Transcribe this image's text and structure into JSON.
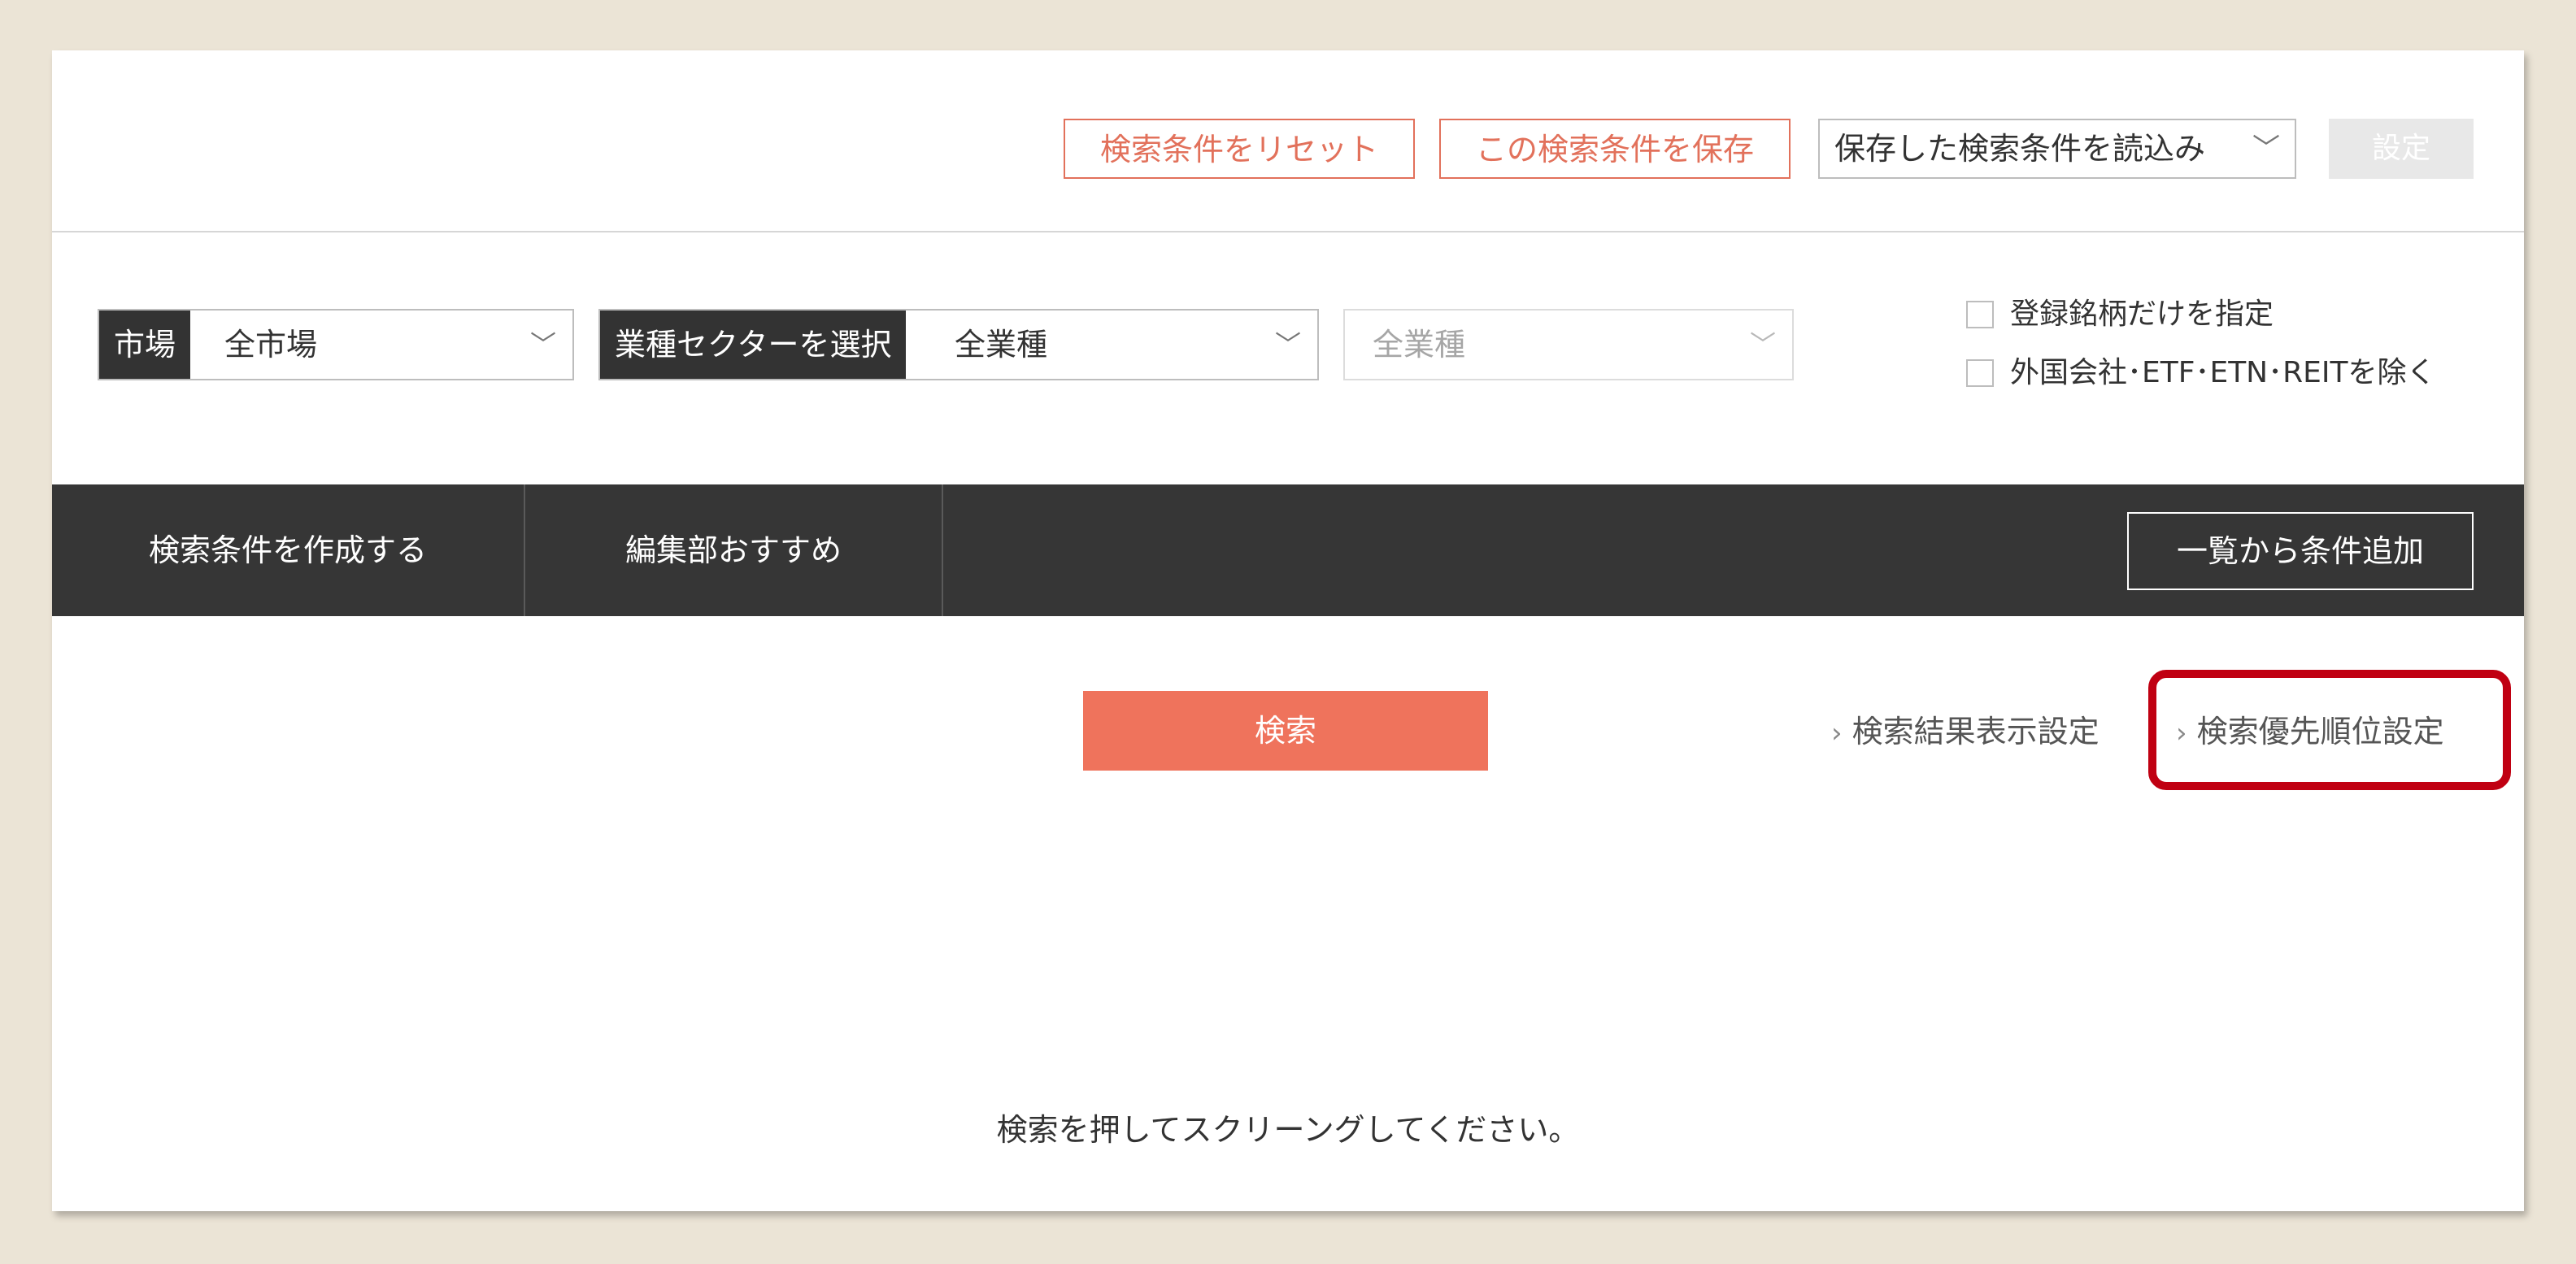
{
  "toolbar": {
    "reset_label": "検索条件をリセット",
    "save_label": "この検索条件を保存",
    "load_label": "保存した検索条件を読込み",
    "set_label": "設定"
  },
  "filters": {
    "market": {
      "tag": "市場",
      "value": "全市場"
    },
    "sector": {
      "tag": "業種セクターを選択",
      "value": "全業種"
    },
    "subsector": {
      "value": "全業種"
    },
    "options": [
      {
        "label": "登録銘柄だけを指定",
        "checked": false
      },
      {
        "label": "外国会社･ETF･ETN･REITを除く",
        "checked": false
      }
    ]
  },
  "tabs": {
    "create_label": "検索条件を作成する",
    "editor_label": "編集部おすすめ",
    "add_condition_label": "一覧から条件追加"
  },
  "search": {
    "button_label": "検索",
    "result_settings_link": "検索結果表示設定",
    "priority_settings_link": "検索優先順位設定"
  },
  "message": "検索を押してスクリーングしてください。",
  "colors": {
    "accent": "#ef735c",
    "outline_accent": "#e2715b",
    "dark_bar": "#363636",
    "highlight": "#c00012",
    "background": "#ebe4d6"
  },
  "icons": {
    "dropdown": "chevron-down-icon",
    "link_arrow": "chevron-right-icon"
  }
}
